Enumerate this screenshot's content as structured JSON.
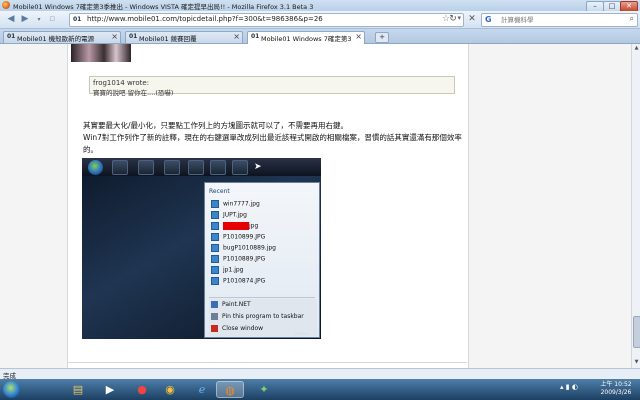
{
  "window": {
    "title": "Mobile01 Windows 7確定第3季推出 - Windows VISTA 確定提早出局!! - Mozilla Firefox 3.1 Beta 3",
    "minimize": "–",
    "maximize": "□",
    "close": "✕"
  },
  "navbar": {
    "url": "http://www.mobile01.com/topicdetail.php?f=300&t=986386&p=26",
    "search_placeholder": "計算機科學"
  },
  "tabs": [
    {
      "label": "Mobile01 機殼歐新的電源"
    },
    {
      "label": "Mobile01 競賽回覆"
    },
    {
      "label": "Mobile01 Windows 7確定第3季推..."
    }
  ],
  "quote": {
    "author": "frog1014 wrote:",
    "text": "寶寶的說吧 留你在....(恐嚇)"
  },
  "post": {
    "line1": "其實要最大化/最小化，只要點工作列上的方塊圖示就可以了，不需要再用右鍵。",
    "line2": "Win7對工作列作了新的註釋，現在的右鍵選單改成列出最近該程式開啟的相關檔案，習慣的話其實還滿有那個效率的。"
  },
  "jumplist": {
    "header": "Recent",
    "items": [
      {
        "label": "win7777.jpg"
      },
      {
        "label": "JUPT.jpg"
      },
      {
        "label": "jpg"
      },
      {
        "label": "P1010899.JPG"
      },
      {
        "label": "bugP1010889.jpg"
      },
      {
        "label": "P1010889.JPG"
      },
      {
        "label": "jp1.jpg"
      },
      {
        "label": "P1010874.JPG"
      }
    ],
    "tasks": [
      {
        "label": "Paint.NET",
        "color": "#3a6fb5"
      },
      {
        "label": "Pin this program to taskbar",
        "color": "#6b7f99"
      },
      {
        "label": "Close window",
        "color": "#c62b1e"
      }
    ]
  },
  "statusbar": {
    "text": "完成"
  },
  "taskbar": {
    "clock_time": "上午 10:52",
    "clock_date": "2009/3/26"
  }
}
